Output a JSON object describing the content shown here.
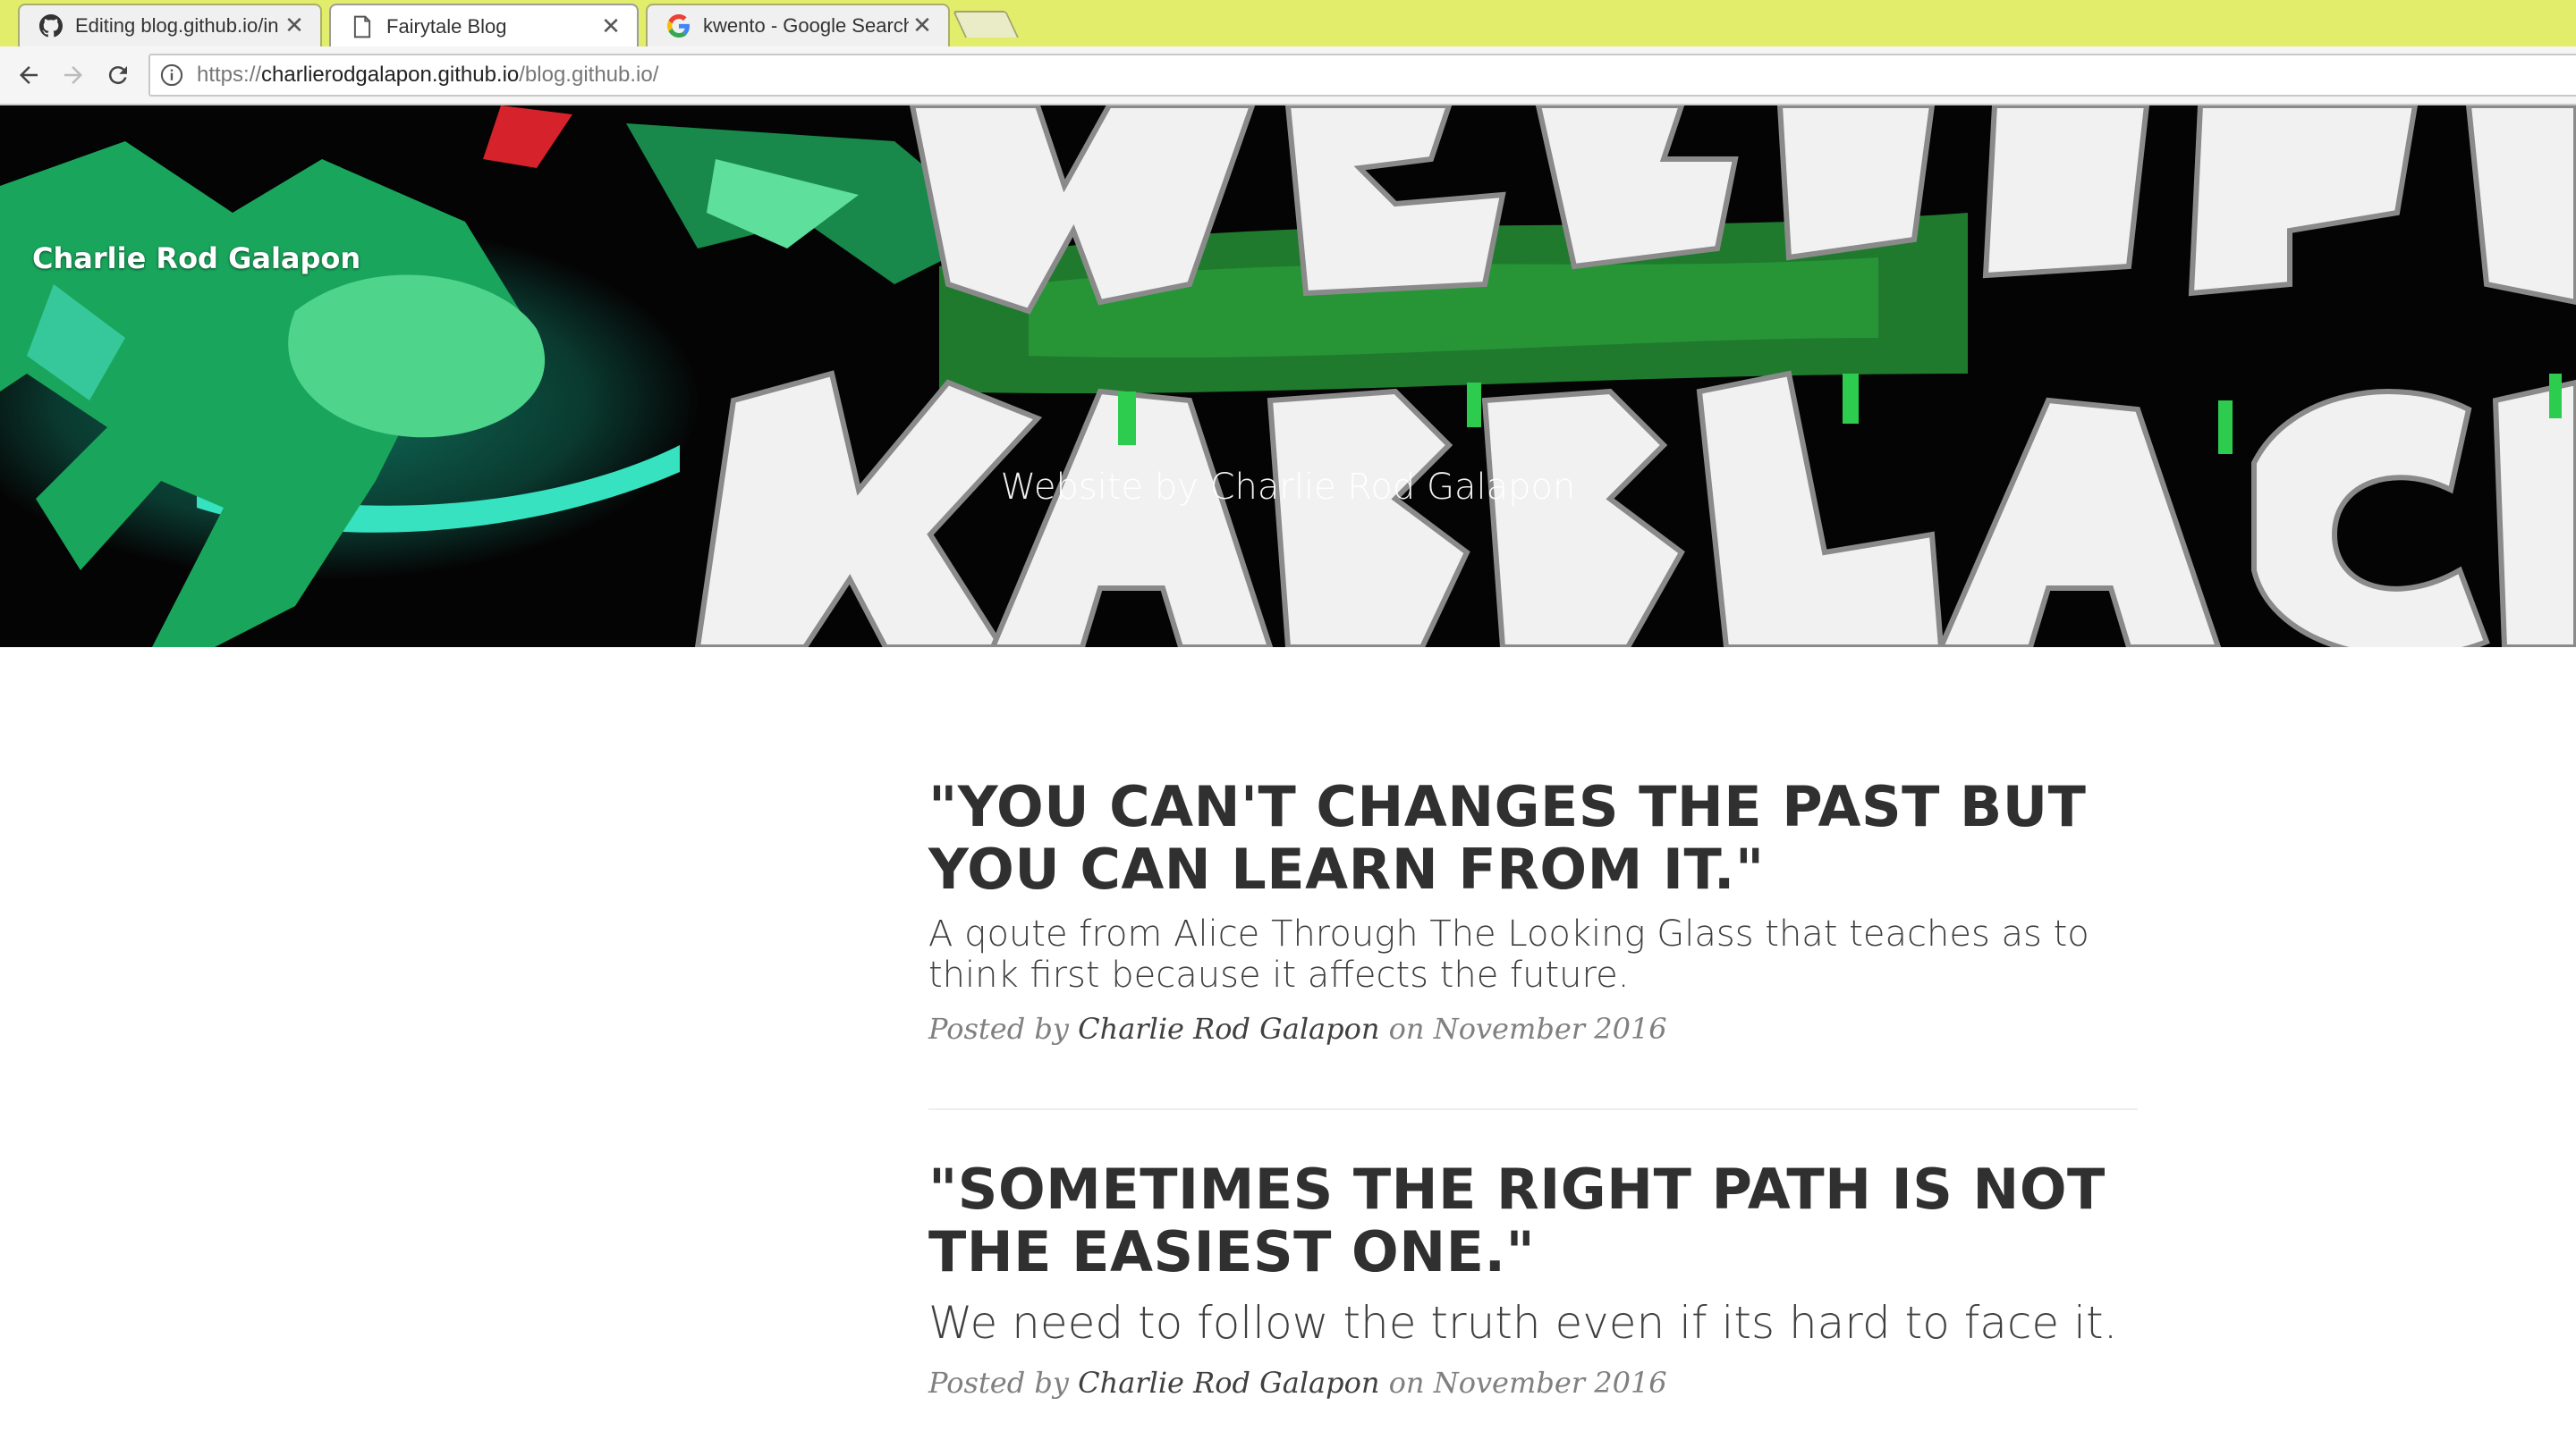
{
  "browser": {
    "tabs": [
      {
        "title": "Editing blog.github.io/in",
        "icon": "github-icon",
        "active": false
      },
      {
        "title": "Fairytale Blog",
        "icon": "page-icon",
        "active": true
      },
      {
        "title": "kwento - Google Search",
        "icon": "google-icon",
        "active": false
      }
    ],
    "close_glyph": "✕",
    "url": {
      "scheme": "https://",
      "host": "charlierodgalapon.github.io",
      "path": "/blog.github.io/"
    },
    "tabstrip_color": "#e2ed6b"
  },
  "site": {
    "brand": "Charlie Rod Galapon",
    "hero_subtitle": "Website by Charlie Rod Galapon"
  },
  "posts": [
    {
      "title": "\"YOU CAN'T CHANGES THE PAST BUT YOU CAN LEARN FROM IT.\"",
      "subtitle": "A qoute from Alice Through The Looking Glass that teaches as to think first because it affects the future.",
      "meta_prefix": "Posted by",
      "author": "Charlie Rod Galapon",
      "meta_on": "on",
      "date": "November 2016"
    },
    {
      "title": "\"SOMETIMES THE RIGHT PATH IS NOT THE EASIEST ONE.\"",
      "subtitle": "We need to follow the truth even if its hard to face it.",
      "meta_prefix": "Posted by",
      "author": "Charlie Rod Galapon",
      "meta_on": "on",
      "date": "November 2016"
    }
  ]
}
